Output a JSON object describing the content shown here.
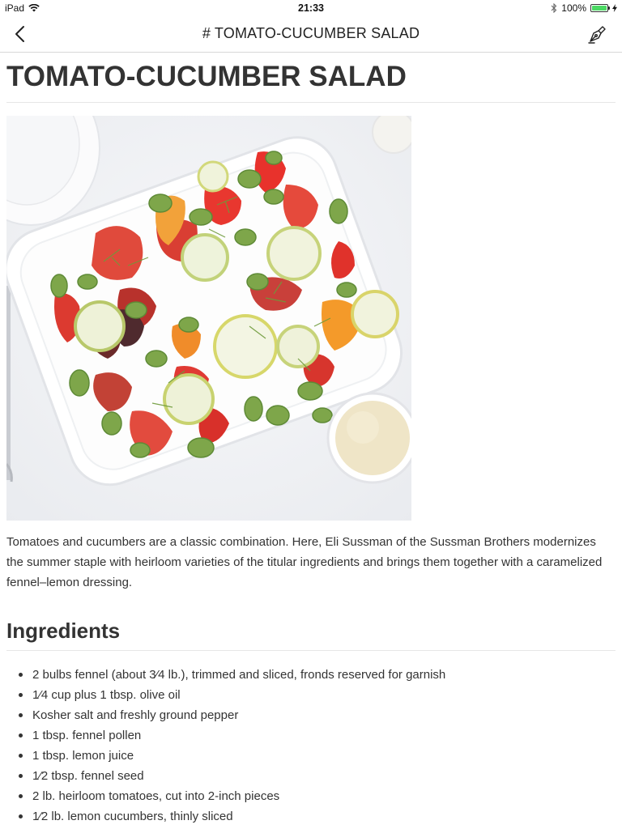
{
  "status_bar": {
    "device": "iPad",
    "time": "21:33",
    "battery": "100%"
  },
  "nav": {
    "title": "# TOMATO-CUCUMBER SALAD",
    "back_icon": "chevron-left-icon",
    "edit_icon": "pen-nib-icon"
  },
  "recipe": {
    "title": "TOMATO-CUCUMBER SALAD",
    "description": "Tomatoes and cucumbers are a classic combination. Here, Eli Sussman of the Sussman Brothers modernizes the summer staple with heirloom varieties of the titular ingredients and brings them together with a caramelized fennel–lemon dressing.",
    "ingredients_heading": "Ingredients",
    "ingredients": [
      "2 bulbs fennel (about 3⁄4 lb.), trimmed and sliced, fronds reserved for garnish",
      "1⁄4 cup plus 1 tbsp. olive oil",
      "Kosher salt and freshly ground pepper",
      "1 tbsp. fennel pollen",
      "1 tbsp. lemon juice",
      "1⁄2 tbsp. fennel seed",
      "2 lb. heirloom tomatoes, cut into 2-inch pieces",
      "1⁄2 lb. lemon cucumbers, thinly sliced"
    ]
  },
  "colors": {
    "accent": "#333333",
    "divider": "#e6e6e6",
    "battery": "#4cd964"
  }
}
